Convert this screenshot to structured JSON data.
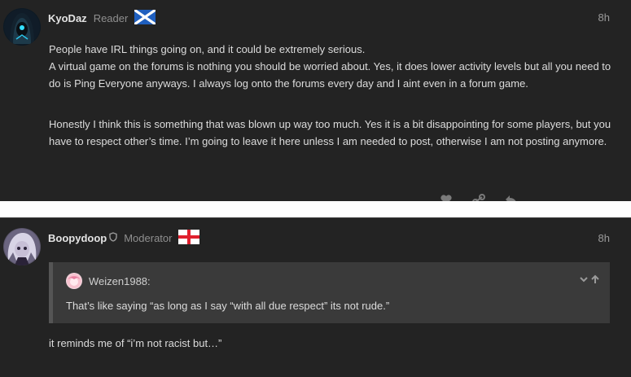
{
  "posts": [
    {
      "author": "KyoDaz",
      "title": "Reader",
      "flag": "scotland-flag",
      "time": "8h",
      "paragraphs": [
        [
          "People have IRL things going on, and it could be extremely serious.",
          "A virtual game on the forums is nothing you should be worried about. Yes, it does lower activity levels but all you need to do is Ping Everyone anyways. I always log onto the forums every day and I aint even in a forum game."
        ],
        [
          "Honestly I think this is something that was blown up way too much. Yes it is a bit disappointing for some players, but you have to respect other’s time. I’m going to leave it here unless I am needed to post, otherwise I am not posting anymore."
        ]
      ],
      "actions": [
        "heart-icon",
        "link-icon",
        "reply-icon"
      ]
    },
    {
      "author": "Boopydoop",
      "title": "Moderator",
      "flag": "england-flag",
      "badge": "moderator-shield-icon",
      "time": "8h",
      "quote": {
        "author": "Weizen1988:",
        "text": "That’s like saying “as long as I say “with all due respect” its not rude.”",
        "controls": [
          "chevron-down-icon",
          "arrow-up-icon"
        ]
      },
      "text": "it reminds me of “i’m not racist but…”"
    }
  ],
  "colors": {
    "background": "#232323",
    "quote_background": "#3a3a3a",
    "divider": "#ffffff",
    "scotland_blue": "#1f5fbf",
    "england_red": "#e0202e"
  }
}
